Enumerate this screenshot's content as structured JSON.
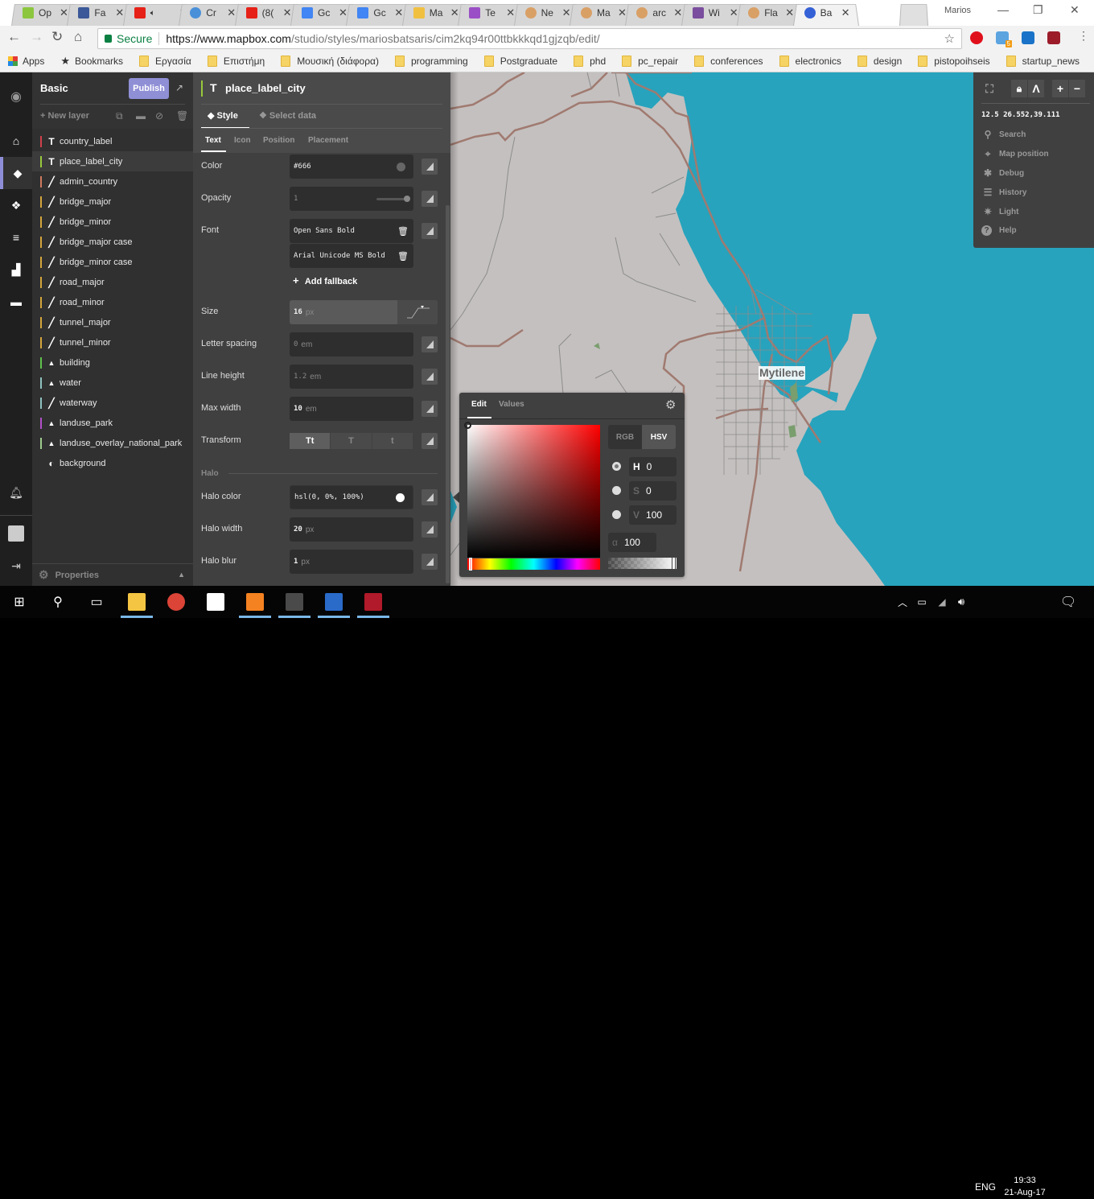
{
  "browser": {
    "tabs": [
      {
        "title": "Op",
        "icon": "map-search-icon",
        "color": "#8cc63f"
      },
      {
        "title": "Fa",
        "icon": "facebook-icon",
        "color": "#3b5998"
      },
      {
        "title": "",
        "icon": "youtube-icon",
        "color": "#e62117",
        "audio": true
      },
      {
        "title": "Cr",
        "icon": "webcam-icon",
        "color": "#4a90d9"
      },
      {
        "title": "(8(",
        "icon": "youtube-icon",
        "color": "#e62117"
      },
      {
        "title": "Gc",
        "icon": "google-icon",
        "color": "#4285f4"
      },
      {
        "title": "Gc",
        "icon": "google-icon",
        "color": "#4285f4"
      },
      {
        "title": "Ma",
        "icon": "bookmark-b-icon",
        "color": "#f0c040"
      },
      {
        "title": "Te",
        "icon": "triangle-icon",
        "color": "#9b4fc6"
      },
      {
        "title": "Ne",
        "icon": "site-icon",
        "color": "#d9a066"
      },
      {
        "title": "Ma",
        "icon": "site-icon",
        "color": "#d9a066"
      },
      {
        "title": "arc",
        "icon": "site-icon",
        "color": "#d9a066"
      },
      {
        "title": "Wi",
        "icon": "wikidata-icon",
        "color": "#7b4d9e"
      },
      {
        "title": "Fla",
        "icon": "site-icon",
        "color": "#d9a066"
      },
      {
        "title": "Ba",
        "icon": "mapbox-icon",
        "color": "#3561d6",
        "active": true
      }
    ],
    "profile_name": "Marios",
    "secure_label": "Secure",
    "url_host": "https://www.mapbox.com",
    "url_path": "/studio/styles/mariosbatsaris/cim2kq94r00ttbkkkqd1gjzqb/edit/",
    "bookmarks": [
      {
        "label": "Apps",
        "icon": "apps-grid-icon"
      },
      {
        "label": "Bookmarks",
        "icon": "star-icon"
      },
      {
        "label": "Εργασία",
        "icon": "folder-icon"
      },
      {
        "label": "Επιστήμη",
        "icon": "folder-icon"
      },
      {
        "label": "Μουσική (διάφορα)",
        "icon": "folder-icon"
      },
      {
        "label": "programming",
        "icon": "folder-icon"
      },
      {
        "label": "Postgraduate",
        "icon": "folder-icon"
      },
      {
        "label": "phd",
        "icon": "folder-icon"
      },
      {
        "label": "pc_repair",
        "icon": "folder-icon"
      },
      {
        "label": "conferences",
        "icon": "folder-icon"
      },
      {
        "label": "electronics",
        "icon": "folder-icon"
      },
      {
        "label": "design",
        "icon": "folder-icon"
      },
      {
        "label": "pistopoihseis",
        "icon": "folder-icon"
      },
      {
        "label": "startup_news",
        "icon": "folder-icon"
      }
    ],
    "extensions": [
      {
        "name": "opera-vpn-icon",
        "color": "#e0101b"
      },
      {
        "name": "ghostery-icon",
        "color": "#5ba4e0",
        "badge": "5"
      },
      {
        "name": "skype-icon",
        "color": "#1a73c8"
      },
      {
        "name": "mendeley-icon",
        "color": "#9c1c2a"
      }
    ]
  },
  "studio": {
    "style_name": "Basic",
    "publish_label": "Publish",
    "new_layer_label": "New layer",
    "layers": [
      {
        "name": "country_label",
        "type": "symbol",
        "color": "#d0414b"
      },
      {
        "name": "place_label_city",
        "type": "symbol",
        "color": "#98c93c",
        "selected": true
      },
      {
        "name": "admin_country",
        "type": "line",
        "color": "#d07a5e"
      },
      {
        "name": "bridge_major",
        "type": "line",
        "color": "#d4a63c"
      },
      {
        "name": "bridge_minor",
        "type": "line",
        "color": "#d4a63c"
      },
      {
        "name": "bridge_major case",
        "type": "line",
        "color": "#d4a63c"
      },
      {
        "name": "bridge_minor case",
        "type": "line",
        "color": "#d4a63c"
      },
      {
        "name": "road_major",
        "type": "line",
        "color": "#d4a63c"
      },
      {
        "name": "road_minor",
        "type": "line",
        "color": "#d4a63c"
      },
      {
        "name": "tunnel_major",
        "type": "line",
        "color": "#d4a63c"
      },
      {
        "name": "tunnel_minor",
        "type": "line",
        "color": "#d4a63c"
      },
      {
        "name": "building",
        "type": "fill",
        "color": "#5fc14d"
      },
      {
        "name": "water",
        "type": "fill",
        "color": "#8ec2c0"
      },
      {
        "name": "waterway",
        "type": "line",
        "color": "#8ec2c0"
      },
      {
        "name": "landuse_park",
        "type": "fill",
        "color": "#b24fc9"
      },
      {
        "name": "landuse_overlay_national_park",
        "type": "fill",
        "color": "#9ccc8c"
      },
      {
        "name": "background",
        "type": "background",
        "color": ""
      }
    ],
    "properties_label": "Properties"
  },
  "panel": {
    "layer_title": "place_label_city",
    "tabs": {
      "style": "Style",
      "select_data": "Select data"
    },
    "subtabs": [
      "Text",
      "Icon",
      "Position",
      "Placement"
    ],
    "active_subtab": "Text",
    "props": {
      "color": {
        "label": "Color",
        "value": "#666",
        "swatch": "#666666"
      },
      "opacity": {
        "label": "Opacity",
        "value": "1"
      },
      "font": {
        "label": "Font",
        "fonts": [
          "Open Sans Bold",
          "Arial Unicode MS Bold"
        ],
        "add_fallback": "Add fallback"
      },
      "size": {
        "label": "Size",
        "value": "16",
        "unit": "px"
      },
      "letter_spacing": {
        "label": "Letter spacing",
        "value": "0",
        "unit": "em"
      },
      "line_height": {
        "label": "Line height",
        "value": "1.2",
        "unit": "em"
      },
      "max_width": {
        "label": "Max width",
        "value": "10",
        "unit": "em"
      },
      "transform": {
        "label": "Transform",
        "options": [
          "Tt",
          "T",
          "t"
        ],
        "selected": "Tt"
      },
      "halo_section": "Halo",
      "halo_color": {
        "label": "Halo color",
        "value": "hsl(0, 0%, 100%)",
        "swatch": "#ffffff"
      },
      "halo_width": {
        "label": "Halo width",
        "value": "20",
        "unit": "px"
      },
      "halo_blur": {
        "label": "Halo blur",
        "value": "1",
        "unit": "px"
      }
    }
  },
  "color_picker": {
    "tabs": [
      "Edit",
      "Values"
    ],
    "active_tab": "Edit",
    "modes": [
      "RGB",
      "HSV"
    ],
    "active_mode": "HSV",
    "h": {
      "key": "H",
      "value": "0"
    },
    "s": {
      "key": "S",
      "value": "0"
    },
    "v": {
      "key": "V",
      "value": "100"
    },
    "alpha": {
      "key": "α",
      "value": "100"
    }
  },
  "map": {
    "city_label": "Mytilene",
    "zoom_coords": "12.5 26.552,39.111",
    "colors": {
      "land": "#c4c0bf",
      "water": "#27a3bd",
      "major_road": "#a07a70",
      "minor_road": "#8c8c8c",
      "park": "#7a9e6e"
    },
    "menu": [
      {
        "label": "Search",
        "icon": "search-icon"
      },
      {
        "label": "Map position",
        "icon": "crosshair-icon"
      },
      {
        "label": "Debug",
        "icon": "bug-icon"
      },
      {
        "label": "History",
        "icon": "history-icon"
      },
      {
        "label": "Light",
        "icon": "light-icon"
      },
      {
        "label": "Help",
        "icon": "help-icon"
      }
    ]
  },
  "taskbar": {
    "apps": [
      "file-explorer-icon",
      "chrome-icon",
      "mail-icon",
      "xampp-icon",
      "sublime-text-icon",
      "libreoffice-writer-icon",
      "mendeley-icon"
    ],
    "language": "ENG",
    "time": "19:33",
    "date": "21-Aug-17"
  }
}
